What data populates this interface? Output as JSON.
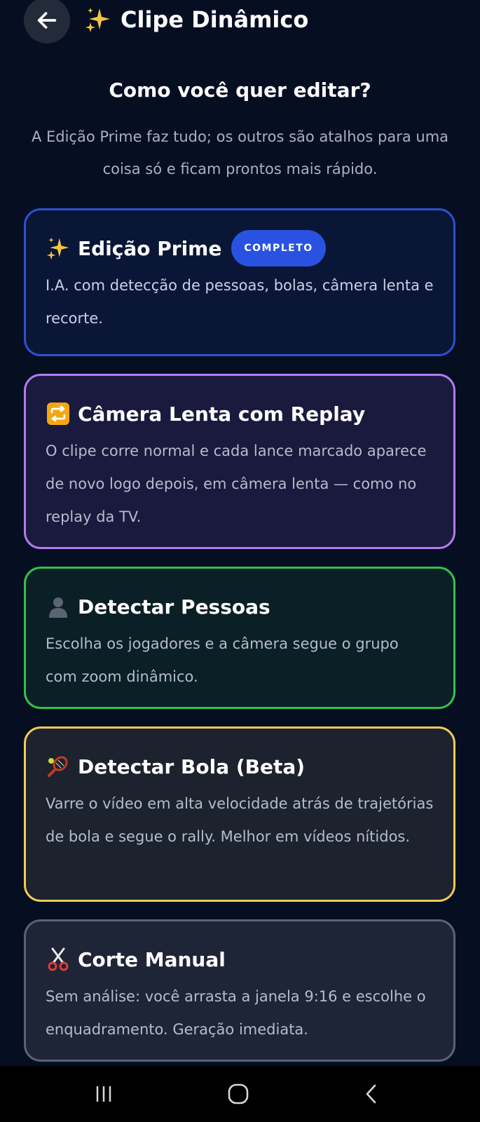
{
  "header": {
    "back_icon": "arrow-left-icon",
    "title_icon": "sparkles-icon",
    "title": "Clipe Dinâmico"
  },
  "heading": "Como você quer editar?",
  "intro": "A Edição Prime faz tudo; os outros são atalhos para uma coisa só e ficam prontos mais rápido.",
  "options": [
    {
      "icon": "sparkles-icon",
      "title": "Edição Prime",
      "badge": "COMPLETO",
      "description": "I.A. com detecção de pessoas, bolas, câmera lenta e recorte.",
      "border_color": "#2f4fd0"
    },
    {
      "icon": "repeat-icon",
      "title": "Câmera Lenta com Replay",
      "description": "O clipe corre normal e cada lance marcado aparece de novo logo depois, em câmera lenta — como no replay da TV.",
      "border_color": "#b57aee"
    },
    {
      "icon": "person-icon",
      "title": "Detectar Pessoas",
      "description": "Escolha os jogadores e a câmera segue o grupo com zoom dinâmico.",
      "border_color": "#33c14a"
    },
    {
      "icon": "tennis-icon",
      "title": "Detectar Bola (Beta)",
      "description": "Varre o vídeo em alta velocidade atrás de trajetórias de bola e segue o rally. Melhor em vídeos nítidos.",
      "border_color": "#f0cc50"
    },
    {
      "icon": "scissors-icon",
      "title": "Corte Manual",
      "description": "Sem análise: você arrasta a janela 9:16 e escolhe o enquadramento. Geração imediata.",
      "border_color": "#5a6275"
    }
  ],
  "navbar": {
    "recents_icon": "recents-icon",
    "home_icon": "home-icon",
    "back_icon": "nav-back-icon"
  }
}
